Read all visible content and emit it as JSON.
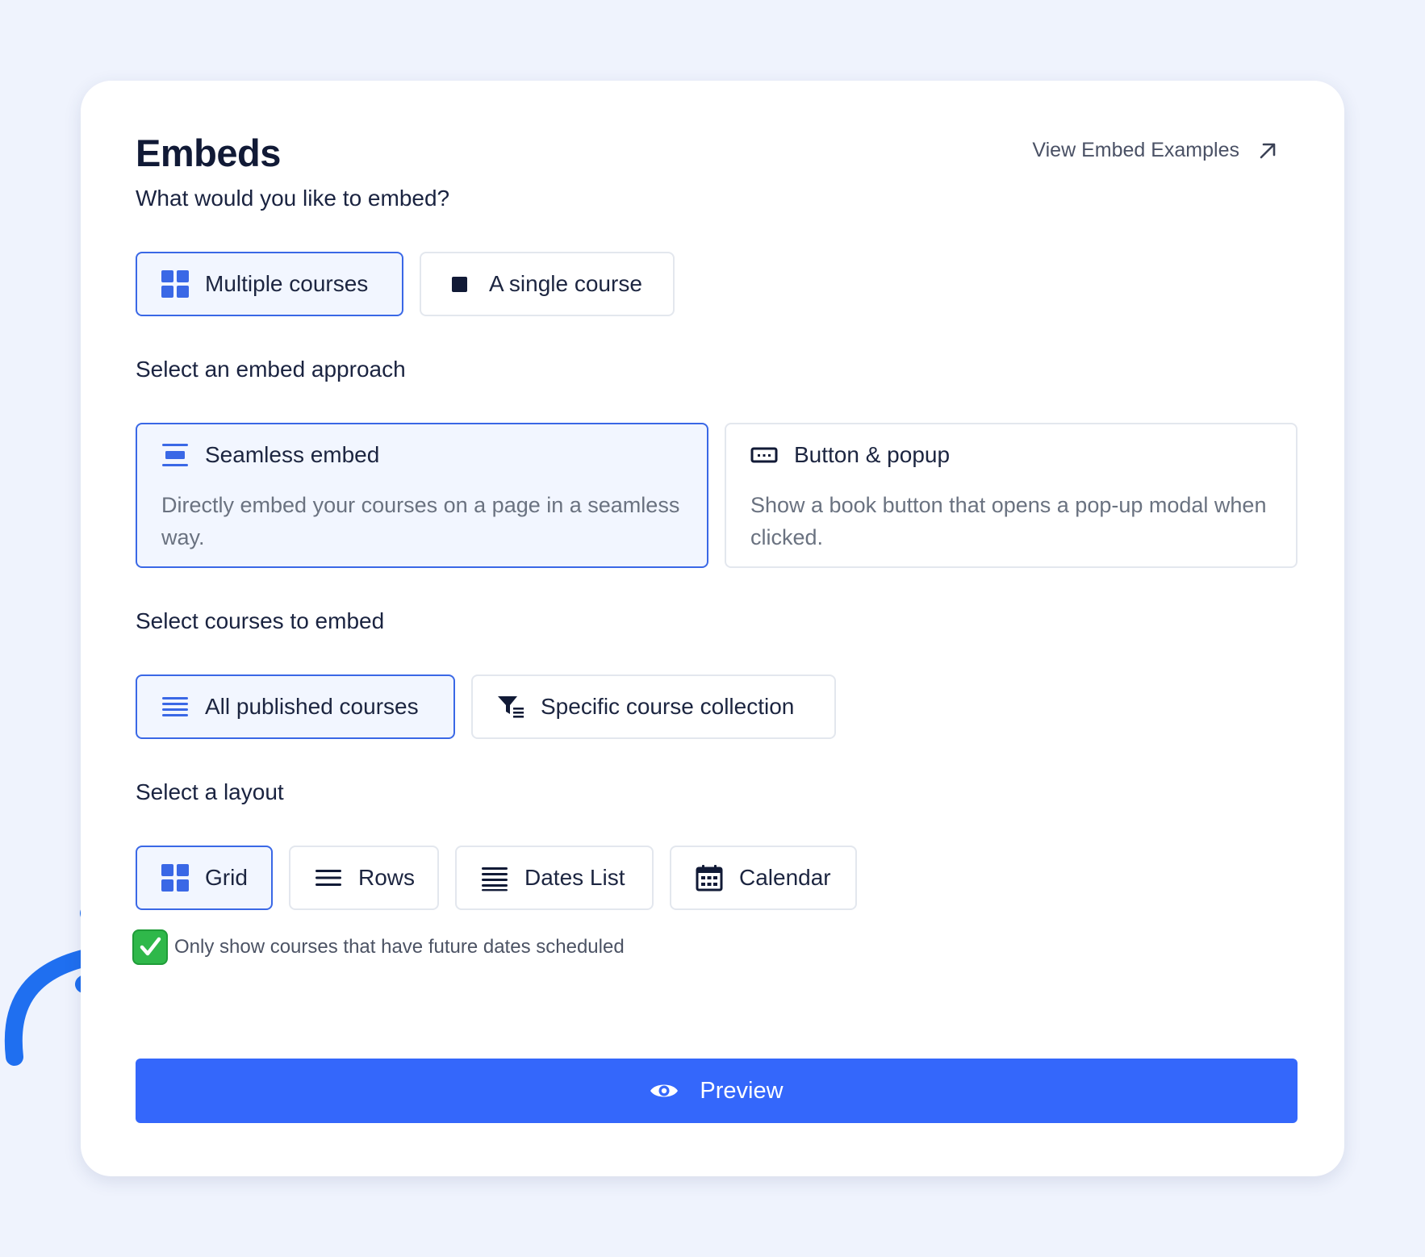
{
  "header": {
    "title": "Embeds",
    "examples_link": "View Embed Examples"
  },
  "embed_type": {
    "label": "What would you like to embed?",
    "options": [
      {
        "label": "Multiple courses",
        "icon": "grid-icon",
        "selected": true
      },
      {
        "label": "A single course",
        "icon": "square-icon",
        "selected": false
      }
    ]
  },
  "approach": {
    "label": "Select an embed approach",
    "options": [
      {
        "title": "Seamless embed",
        "description": "Directly embed your courses on a page in a seamless way.",
        "icon": "seamless-embed-icon",
        "selected": true
      },
      {
        "title": "Button & popup",
        "description": "Show a book button that opens a pop-up modal when clicked.",
        "icon": "button-popup-icon",
        "selected": false
      }
    ]
  },
  "courses": {
    "label": "Select courses to embed",
    "options": [
      {
        "label": "All published courses",
        "icon": "list-icon",
        "selected": true
      },
      {
        "label": "Specific course collection",
        "icon": "filter-list-icon",
        "selected": false
      }
    ]
  },
  "layout": {
    "label": "Select a layout",
    "options": [
      {
        "label": "Grid",
        "icon": "grid-icon",
        "selected": true
      },
      {
        "label": "Rows",
        "icon": "rows-icon",
        "selected": false
      },
      {
        "label": "Dates List",
        "icon": "dates-list-icon",
        "selected": false
      },
      {
        "label": "Calendar",
        "icon": "calendar-icon",
        "selected": false
      }
    ]
  },
  "future_dates": {
    "label": "Only show courses that have future dates scheduled",
    "checked": true
  },
  "preview": {
    "label": "Preview"
  },
  "colors": {
    "accent": "#3467fb",
    "selected_border": "#3a68e6",
    "selected_bg": "#f2f6ff",
    "check_green": "#2fb84a",
    "annotation_arrow": "#1f6ff0"
  }
}
